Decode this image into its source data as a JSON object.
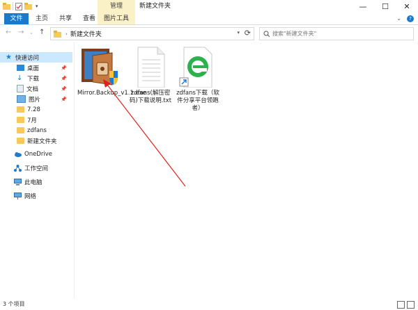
{
  "window": {
    "title": "新建文件夹",
    "tool_tab": "管理",
    "controls": {
      "minimize": "—",
      "maximize": "☐",
      "close": "✕"
    }
  },
  "ribbon": {
    "tabs": [
      "文件",
      "主页",
      "共享",
      "查看",
      "图片工具"
    ],
    "right_chevron": "⌄",
    "help": "?"
  },
  "nav": {
    "back": "←",
    "forward": "→",
    "recent": "⌄",
    "up": "↑",
    "address_chevron": "›",
    "address_path": "新建文件夹",
    "search_placeholder": "搜索\"新建文件夹\""
  },
  "sidebar": {
    "items": [
      {
        "label": "快速访问",
        "icon": "star-icon",
        "selected": true
      },
      {
        "label": "桌面",
        "icon": "desktop-icon",
        "pinned": true
      },
      {
        "label": "下载",
        "icon": "download-icon",
        "pinned": true
      },
      {
        "label": "文档",
        "icon": "document-icon",
        "pinned": true
      },
      {
        "label": "图片",
        "icon": "pictures-icon",
        "pinned": true
      },
      {
        "label": "7.28",
        "icon": "folder-icon"
      },
      {
        "label": "7月",
        "icon": "folder-icon"
      },
      {
        "label": "zdfans",
        "icon": "folder-icon"
      },
      {
        "label": "新建文件夹",
        "icon": "folder-icon"
      },
      {
        "label": "OneDrive",
        "icon": "cloud-icon"
      },
      {
        "label": "工作空间",
        "icon": "network-workspace-icon"
      },
      {
        "label": "此电脑",
        "icon": "computer-icon"
      },
      {
        "label": "网络",
        "icon": "network-icon"
      }
    ]
  },
  "files": [
    {
      "name": "Mirror.Backup_v1.1.exe",
      "icon": "installer-exe-icon"
    },
    {
      "name": "zdfans(解压密码)下载说明.txt",
      "icon": "text-file-icon"
    },
    {
      "name": "zdfans下载（软件分享平台领跑者）",
      "icon": "ie-shortcut-icon"
    }
  ],
  "status": {
    "count": "3 个项目"
  },
  "colors": {
    "accent": "#1979ca",
    "tool_tab": "#fbf1c7",
    "selected": "#cce8ff",
    "annotation_arrow": "#e02020"
  }
}
